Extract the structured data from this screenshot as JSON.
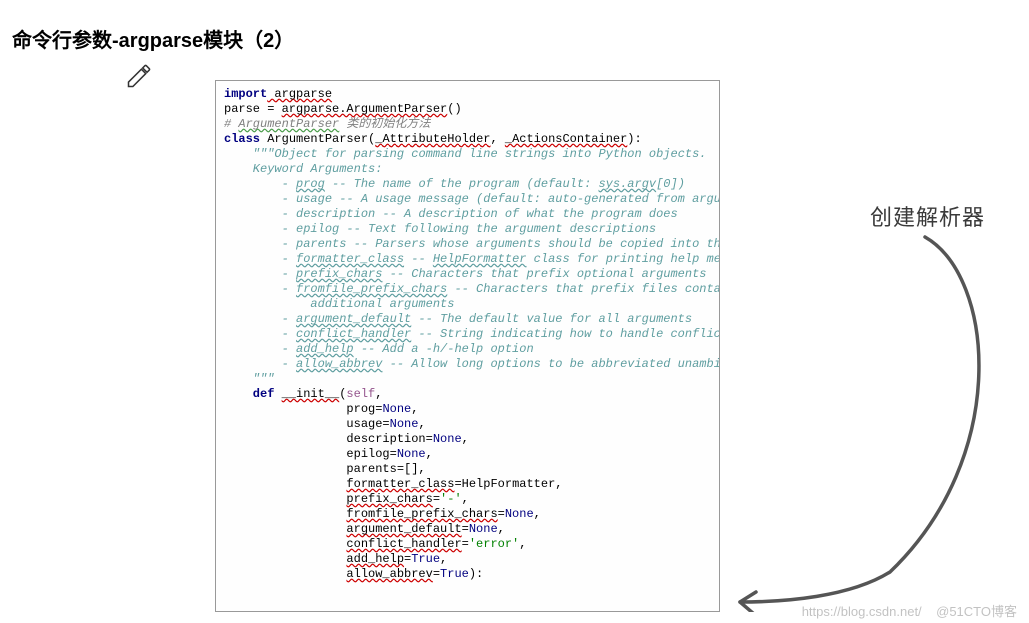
{
  "title": "命令行参数-argparse模块（2）",
  "annotation": "创建解析器",
  "watermark_left": "https://blog.csdn.net/",
  "watermark_right": "@51CTO博客",
  "code": {
    "import_kw": "import",
    "argparse": " argparse",
    "line2_a": "parse = ",
    "line2_b": "argparse.ArgumentParser",
    "line2_c": "()",
    "comment1_a": "# ",
    "comment1_b": "ArgumentParser",
    "comment1_c": " 类的初始化方法",
    "class_kw": "class ",
    "class_name": "ArgumentParser",
    "class_par1": "(",
    "class_arg1": "_AttributeHolder",
    "class_sep": ", ",
    "class_arg2": "_ActionsContainer",
    "class_par2": "):",
    "doc_open": "    \"\"\"",
    "doc_l1": "Object for parsing command line strings into Python objects.",
    "doc_l2": "    Keyword Arguments:",
    "doc_l3a": "        - ",
    "doc_prog": "prog",
    "doc_l3b": " -- The name of the program (default: ",
    "doc_sysargv": "sys.argv",
    "doc_l3c": "[0])",
    "doc_l4": "        - usage -- A usage message (default: auto-generated from arguments)",
    "doc_l5": "        - description -- A description of what the program does",
    "doc_l6": "        - epilog -- Text following the argument descriptions",
    "doc_l7": "        - parents -- Parsers whose arguments should be copied into this one",
    "doc_l8a": "        - ",
    "doc_fmtcls": "formatter_class",
    "doc_l8b": " -- ",
    "doc_helpfmt": "HelpFormatter",
    "doc_l8c": " class for printing help messages",
    "doc_l9a": "        - ",
    "doc_pfxchars": "prefix_chars",
    "doc_l9b": " -- Characters that prefix optional arguments",
    "doc_l10a": "        - ",
    "doc_ffpc": "fromfile_prefix_chars",
    "doc_l10b": " -- Characters that prefix files containing",
    "doc_l11": "            additional arguments",
    "doc_l12a": "        - ",
    "doc_argdef": "argument_default",
    "doc_l12b": " -- The default value for all arguments",
    "doc_l13a": "        - ",
    "doc_confh": "conflict_handler",
    "doc_l13b": " -- String indicating how to handle conflicts",
    "doc_l14a": "        - ",
    "doc_addh": "add_help",
    "doc_l14b": " -- Add a -h/-help option",
    "doc_l15a": "        - ",
    "doc_allowa": "allow_abbrev",
    "doc_l15b": " -- Allow long options to be abbreviated unambiguously",
    "doc_close": "    \"\"\"",
    "def_kw": "    def ",
    "def_name": "__init__",
    "def_open": "(",
    "def_self": "self",
    "def_comma": ",",
    "p_prog_a": "                 prog=",
    "none": "None",
    "p_usage_a": "                 usage=",
    "p_desc_a": "                 description=",
    "p_epilog_a": "                 epilog=",
    "p_parents_a": "                 parents=[],",
    "p_fmt_a": "                 ",
    "p_fmt_name": "formatter_class",
    "p_fmt_eq": "=HelpFormatter,",
    "p_pfx_a": "                 ",
    "p_pfx_name": "prefix_chars",
    "p_pfx_eq": "=",
    "p_pfx_val": "'-'",
    "p_ffpc_a": "                 ",
    "p_ffpc_name": "fromfile_prefix_chars",
    "p_ffpc_eq": "=",
    "p_argdef_a": "                 ",
    "p_argdef_name": "argument_default",
    "p_argdef_eq": "=",
    "p_confh_a": "                 ",
    "p_confh_name": "conflict_handler",
    "p_confh_eq": "=",
    "p_confh_val": "'error'",
    "p_addh_a": "                 ",
    "p_addh_name": "add_help",
    "p_addh_eq": "=",
    "true": "True",
    "p_allowa_a": "                 ",
    "p_allowa_name": "allow_abbrev",
    "p_allowa_eq": "=",
    "close_paren": "):"
  }
}
